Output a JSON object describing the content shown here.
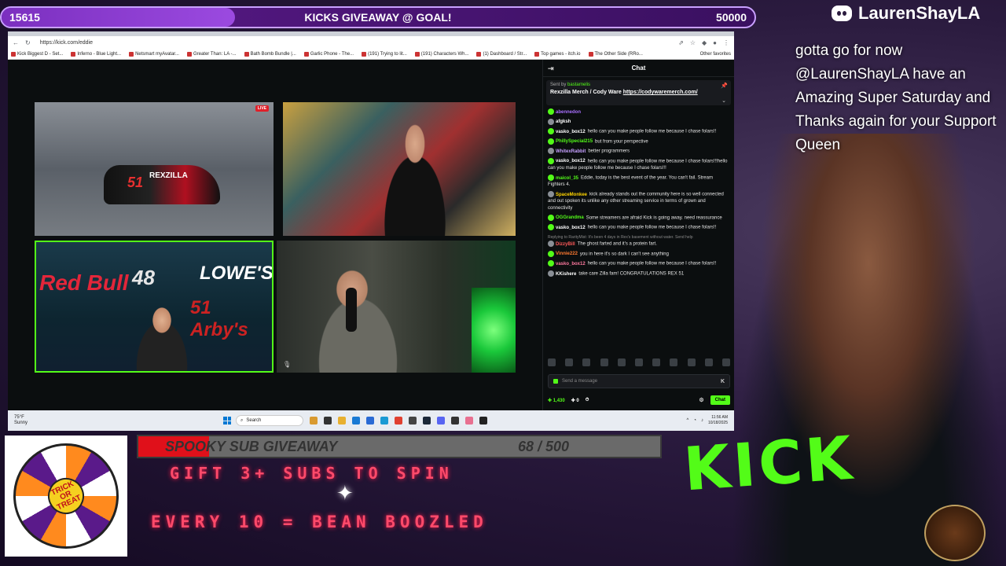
{
  "goal_bar": {
    "current": "15615",
    "title": "KICKS GIVEAWAY @ GOAL!",
    "goal": "50000",
    "progress_fraction": 0.31
  },
  "overlay": {
    "username": "LaurenShayLA",
    "message": "gotta go for now @LaurenShayLA have an Amazing Super Saturday and Thanks again for your Support Queen"
  },
  "browser": {
    "url": "https://kick.com/eddie",
    "bookmarks": [
      "Kick Biggest D - Set...",
      "Inferno - Blue Light...",
      "Netsmart myAvatar...",
      "Greater Than: LA -...",
      "Bath Bomb Bundle |...",
      "Garlic Phone - The...",
      "(191) Trying to lit...",
      "(191) Characters Wh...",
      "(1) Dashboard / Str...",
      "Top games - itch.io",
      "The Other Side (RRo..."
    ],
    "other_bookmarks": "Other favorites"
  },
  "stream": {
    "live_label": "LIVE",
    "car_number": "51",
    "car_brand": "REXZILLA",
    "signs": {
      "redbull": "Red Bull",
      "num48": "48",
      "lowes": "LOWE'S",
      "arby": "51 Arby's"
    }
  },
  "chat": {
    "title": "Chat",
    "pinned": {
      "sent_by_label": "Sent by",
      "sender": "bastarnelis",
      "text": "Rexzilla Merch / Cody Ware",
      "link": "https://codywaremerch.com/"
    },
    "messages": [
      {
        "user": "abennedon",
        "color": "#a970ff",
        "text": "",
        "reply": ""
      },
      {
        "user": "afgksh",
        "color": "#ffffff",
        "text": "",
        "reply": ""
      },
      {
        "user": "vasko_box12",
        "color": "#ffffff",
        "text": "hello can you make people follow me because I chase folars!!",
        "reply": ""
      },
      {
        "user": "PhillySpecial215",
        "color": "#53fc18",
        "text": "but from your perspective",
        "reply": ""
      },
      {
        "user": "WhitexRabbit",
        "color": "#c6a0ff",
        "text": "better programmers",
        "reply": ""
      },
      {
        "user": "vasko_box12",
        "color": "#ffffff",
        "text": "hello can you make people follow me because I chase folars!!!hello can you make people follow me because I chase folars!!!",
        "reply": ""
      },
      {
        "user": "maicol_35",
        "color": "#53fc18",
        "text": "Eddie, today is the best event of the year. You can't fail. Stream Fighters 4.",
        "reply": ""
      },
      {
        "user": "SpaceMonkee",
        "color": "#ffd400",
        "text": "kick already stands out the community here is so well connected and out spoken its unlike any other streaming service in terms of grown and connectivity",
        "reply": ""
      },
      {
        "user": "OGGrandma",
        "color": "#53fc18",
        "text": "Some streamers are afraid Kick is going away. need reassurance",
        "reply": ""
      },
      {
        "user": "vasko_box12",
        "color": "#ffffff",
        "text": "hello can you make people follow me because I chase folars!!",
        "reply": ""
      },
      {
        "user": "DizzyBill",
        "color": "#ff5a5a",
        "text": "The ghost farted and it's a protein fart.",
        "reply": "Replying to RarityMist: It's been 4 days in Rex's basement without water. Send help"
      },
      {
        "user": "Vinnie222",
        "color": "#ff7a30",
        "text": "you in here it's so dark I can't see anything",
        "reply": ""
      },
      {
        "user": "vasko_box12",
        "color": "#ff7aa0",
        "text": "hello can you make people follow me because I chase folars!!",
        "reply": ""
      },
      {
        "user": "KKishere",
        "color": "#ffffff",
        "text": "take care Zilla fam! CONGRATULATIONS REX 51",
        "reply": ""
      }
    ],
    "input_placeholder": "Send a message",
    "points": "1,430",
    "gift_count": "0",
    "chat_button": "Chat"
  },
  "taskbar": {
    "weather_temp": "75°F",
    "weather_desc": "Sunny",
    "search_label": "Search",
    "time": "11:56 AM",
    "date": "10/18/2025"
  },
  "bottom": {
    "sub_goal_title": "SPOOKY SUB GIVEAWAY",
    "sub_goal_count": "68 / 500",
    "sub_goal_fraction": 0.136,
    "promo1": "GIFT 3+ SUBS TO SPIN",
    "promo2": "EVERY 10 = BEAN BOOZLED",
    "wheel_label": "TRICK OR TREAT",
    "hoodie_text": "KICK"
  },
  "colors": {
    "kick_green": "#53fc18",
    "goal_purple": "#7b2fbf",
    "sub_red": "#e0101a"
  }
}
